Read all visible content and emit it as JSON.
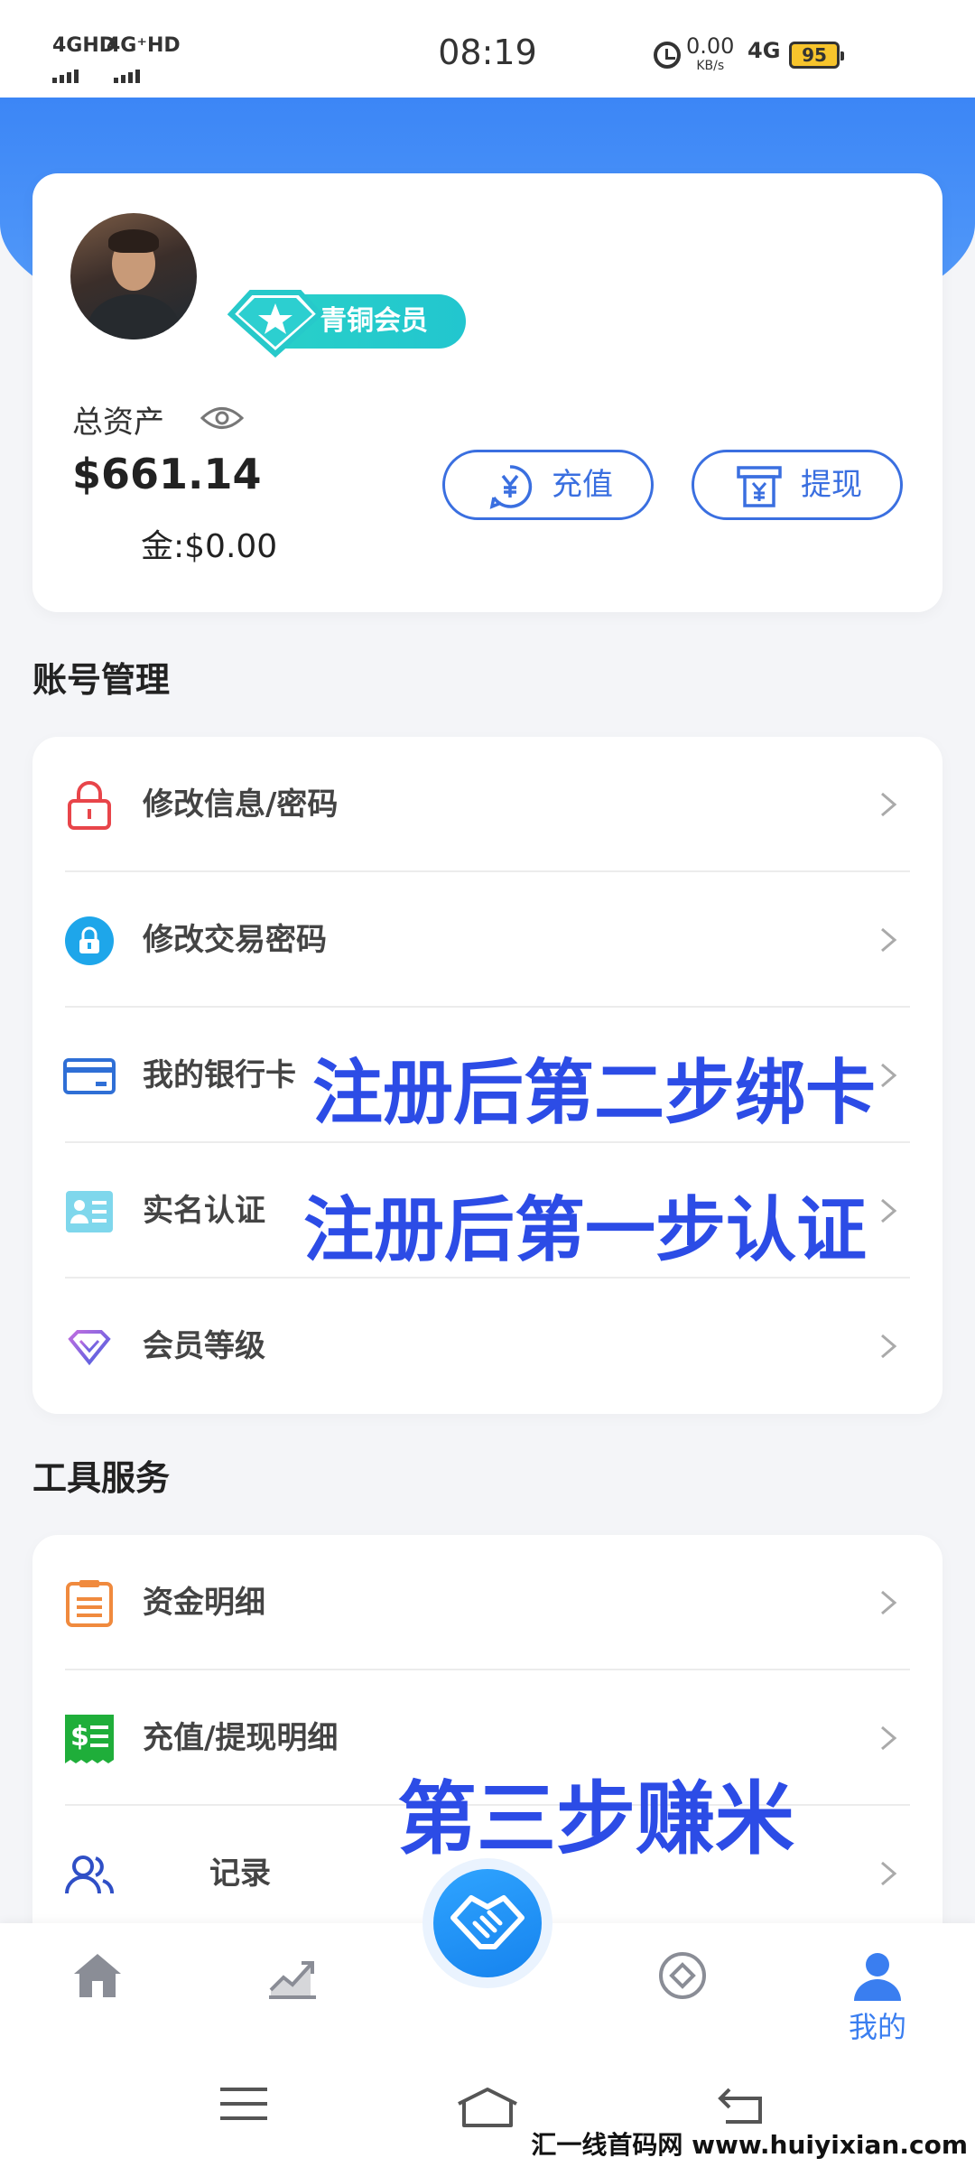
{
  "status_bar": {
    "net1": "4GHD",
    "net2": "4G⁺HD",
    "time": "08:19",
    "speed_value": "0.00",
    "speed_unit": "KB/s",
    "net_right": "4G",
    "battery": "95",
    "battery_color": "#f7c42c"
  },
  "asset_card": {
    "member_level": "青铜会员",
    "total_assets_label": "总资产",
    "total_assets_value": "$661.14",
    "gold_line": "金:$0.00",
    "recharge_label": "充值",
    "withdraw_label": "提现"
  },
  "account_section": {
    "title": "账号管理",
    "items": [
      {
        "label": "修改信息/密码",
        "icon": "lock-icon"
      },
      {
        "label": "修改交易密码",
        "icon": "trade-lock-icon"
      },
      {
        "label": "我的银行卡",
        "icon": "bank-card-icon"
      },
      {
        "label": "实名认证",
        "icon": "id-card-icon"
      },
      {
        "label": "会员等级",
        "icon": "diamond-icon"
      }
    ]
  },
  "tools_section": {
    "title": "工具服务",
    "items": [
      {
        "label": "资金明细",
        "icon": "clipboard-icon"
      },
      {
        "label": "充值/提现明细",
        "icon": "bill-icon"
      },
      {
        "label": "记录",
        "icon": "users-icon"
      }
    ]
  },
  "annotations": {
    "step2": "注册后第二步绑卡",
    "step1": "注册后第一步认证",
    "step3": "第三步赚米"
  },
  "bottom_nav": {
    "items": [
      {
        "icon": "home-icon"
      },
      {
        "icon": "chart-icon"
      },
      {
        "icon": "handshake-icon"
      },
      {
        "icon": "target-icon"
      },
      {
        "icon": "user-icon",
        "label": "我的",
        "active": true
      }
    ],
    "active_color": "#3a7ef0"
  },
  "watermark": {
    "text": "汇一线首码网",
    "url": "www.huiyixian.com"
  },
  "colors": {
    "accent": "#3a6fe0",
    "header_blue": "#3c86f6",
    "annotation_blue": "#2c4ce6"
  }
}
